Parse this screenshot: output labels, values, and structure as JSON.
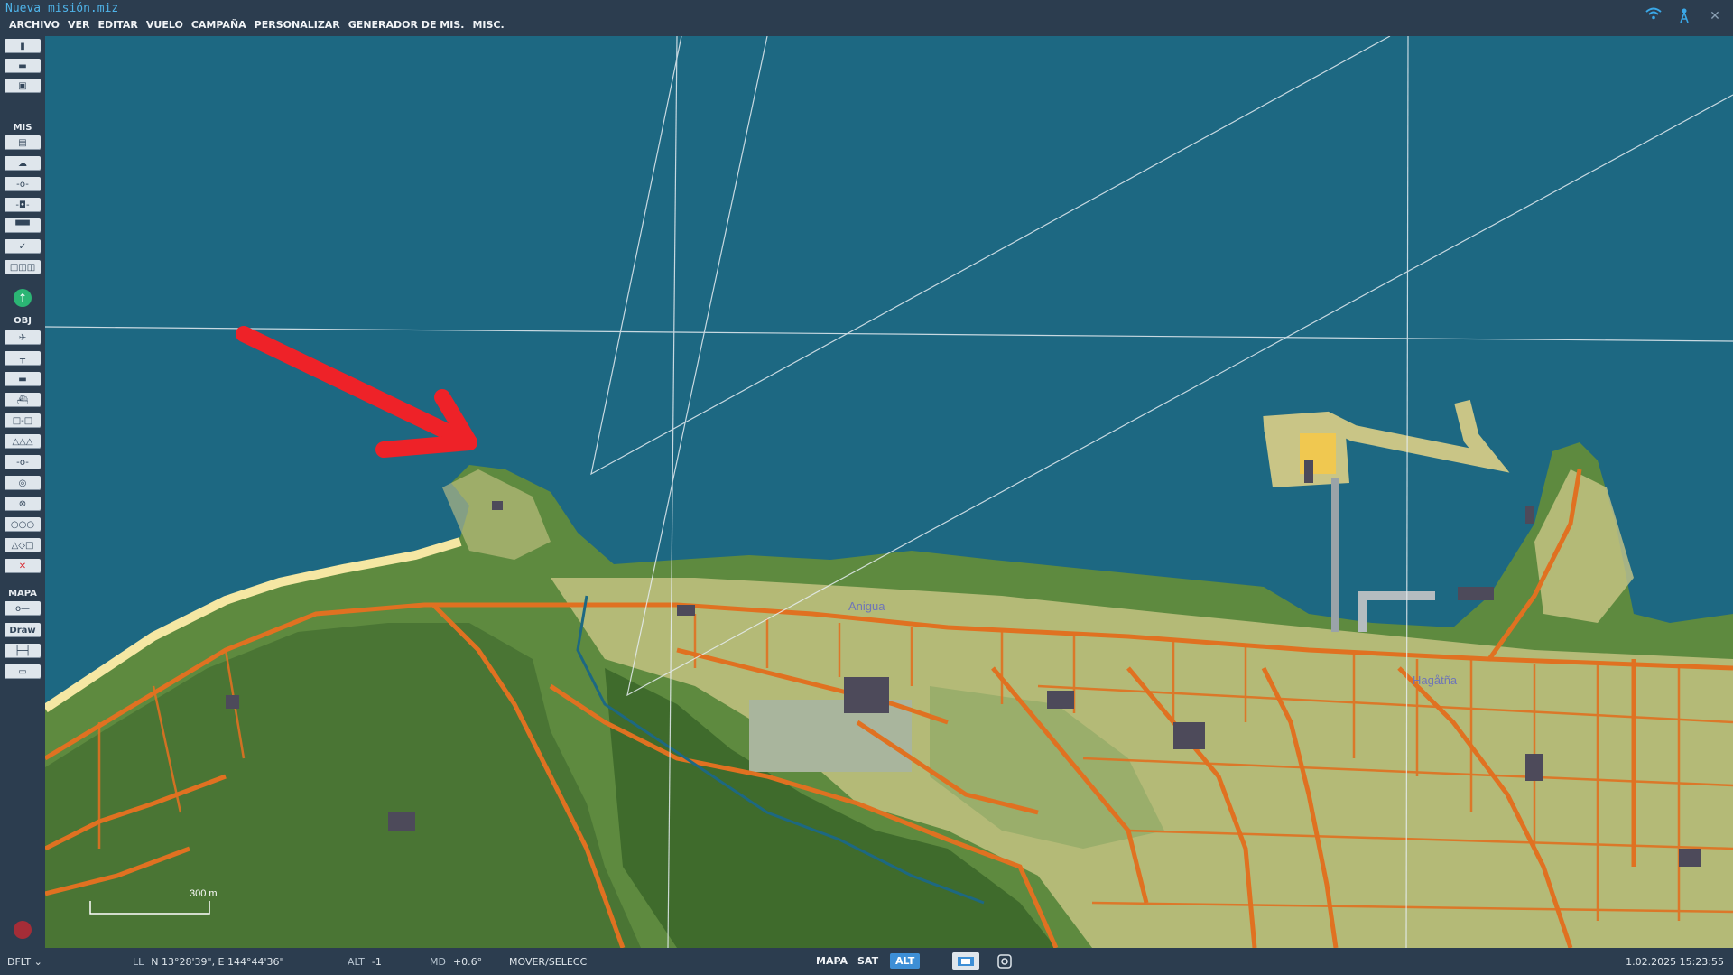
{
  "window": {
    "title": "Nueva misión.miz"
  },
  "menu": [
    "ARCHIVO",
    "VER",
    "EDITAR",
    "VUELO",
    "CAMPAÑA",
    "PERSONALIZAR",
    "GENERADOR DE MIS.",
    "MISC."
  ],
  "tray_icons": [
    "wifi-icon",
    "antenna-icon",
    "close-icon"
  ],
  "sidebar": {
    "sections": {
      "mis": "MIS",
      "obj": "OBJ",
      "mapa": "MAPA"
    },
    "draw_label": "Draw"
  },
  "map": {
    "towns": [
      {
        "name": "Anigua"
      },
      {
        "name": "Hagåtña"
      }
    ],
    "scale": {
      "label": "300 m"
    },
    "colors": {
      "water": "#1d6882",
      "land": "#5e8a3f",
      "road": "#e07121",
      "urban": "#c9c586",
      "forest": "#3f6b2c",
      "arrow": "#ee2228"
    }
  },
  "statusbar": {
    "profile": "DFLT",
    "coords_label": "LL",
    "coords_value": "N 13°28'39\", E 144°44'36\"",
    "alt_label": "ALT",
    "alt_value": "-1",
    "md_label": "MD",
    "md_value": "+0.6°",
    "mode": "MOVER/SELECC",
    "view_buttons": [
      "MAPA",
      "SAT",
      "ALT"
    ],
    "active_view": "ALT",
    "datetime": "1.02.2025 15:23:55"
  }
}
